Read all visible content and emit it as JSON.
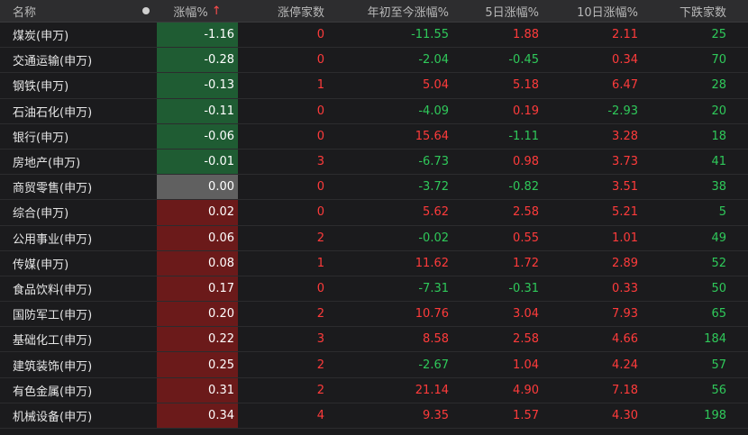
{
  "colors": {
    "up": "#ff3b3b",
    "down": "#2fc95a",
    "bg_up": "#6b1a1a",
    "bg_down": "#1f5c33",
    "bg_flat": "#606060"
  },
  "header": {
    "name": "名称",
    "dot_icon": "filter-dot-icon",
    "change": "涨幅%",
    "sort_icon": "sort-up-arrow-icon",
    "sort_glyph": "↑",
    "limit_up": "涨停家数",
    "ytd": "年初至今涨幅%",
    "d5": "5日涨幅%",
    "d10": "10日涨幅%",
    "down_count": "下跌家数"
  },
  "rows": [
    {
      "name": "煤炭(申万)",
      "change": "-1.16",
      "limit_up": "0",
      "ytd": "-11.55",
      "d5": "1.88",
      "d10": "2.11",
      "down": "25"
    },
    {
      "name": "交通运输(申万)",
      "change": "-0.28",
      "limit_up": "0",
      "ytd": "-2.04",
      "d5": "-0.45",
      "d10": "0.34",
      "down": "70"
    },
    {
      "name": "钢铁(申万)",
      "change": "-0.13",
      "limit_up": "1",
      "ytd": "5.04",
      "d5": "5.18",
      "d10": "6.47",
      "down": "28"
    },
    {
      "name": "石油石化(申万)",
      "change": "-0.11",
      "limit_up": "0",
      "ytd": "-4.09",
      "d5": "0.19",
      "d10": "-2.93",
      "down": "20"
    },
    {
      "name": "银行(申万)",
      "change": "-0.06",
      "limit_up": "0",
      "ytd": "15.64",
      "d5": "-1.11",
      "d10": "3.28",
      "down": "18"
    },
    {
      "name": "房地产(申万)",
      "change": "-0.01",
      "limit_up": "3",
      "ytd": "-6.73",
      "d5": "0.98",
      "d10": "3.73",
      "down": "41"
    },
    {
      "name": "商贸零售(申万)",
      "change": "0.00",
      "limit_up": "0",
      "ytd": "-3.72",
      "d5": "-0.82",
      "d10": "3.51",
      "down": "38"
    },
    {
      "name": "综合(申万)",
      "change": "0.02",
      "limit_up": "0",
      "ytd": "5.62",
      "d5": "2.58",
      "d10": "5.21",
      "down": "5"
    },
    {
      "name": "公用事业(申万)",
      "change": "0.06",
      "limit_up": "2",
      "ytd": "-0.02",
      "d5": "0.55",
      "d10": "1.01",
      "down": "49"
    },
    {
      "name": "传媒(申万)",
      "change": "0.08",
      "limit_up": "1",
      "ytd": "11.62",
      "d5": "1.72",
      "d10": "2.89",
      "down": "52"
    },
    {
      "name": "食品饮料(申万)",
      "change": "0.17",
      "limit_up": "0",
      "ytd": "-7.31",
      "d5": "-0.31",
      "d10": "0.33",
      "down": "50"
    },
    {
      "name": "国防军工(申万)",
      "change": "0.20",
      "limit_up": "2",
      "ytd": "10.76",
      "d5": "3.04",
      "d10": "7.93",
      "down": "65"
    },
    {
      "name": "基础化工(申万)",
      "change": "0.22",
      "limit_up": "3",
      "ytd": "8.58",
      "d5": "2.58",
      "d10": "4.66",
      "down": "184"
    },
    {
      "name": "建筑装饰(申万)",
      "change": "0.25",
      "limit_up": "2",
      "ytd": "-2.67",
      "d5": "1.04",
      "d10": "4.24",
      "down": "57"
    },
    {
      "name": "有色金属(申万)",
      "change": "0.31",
      "limit_up": "2",
      "ytd": "21.14",
      "d5": "4.90",
      "d10": "7.18",
      "down": "56"
    },
    {
      "name": "机械设备(申万)",
      "change": "0.34",
      "limit_up": "4",
      "ytd": "9.35",
      "d5": "1.57",
      "d10": "4.30",
      "down": "198"
    }
  ]
}
